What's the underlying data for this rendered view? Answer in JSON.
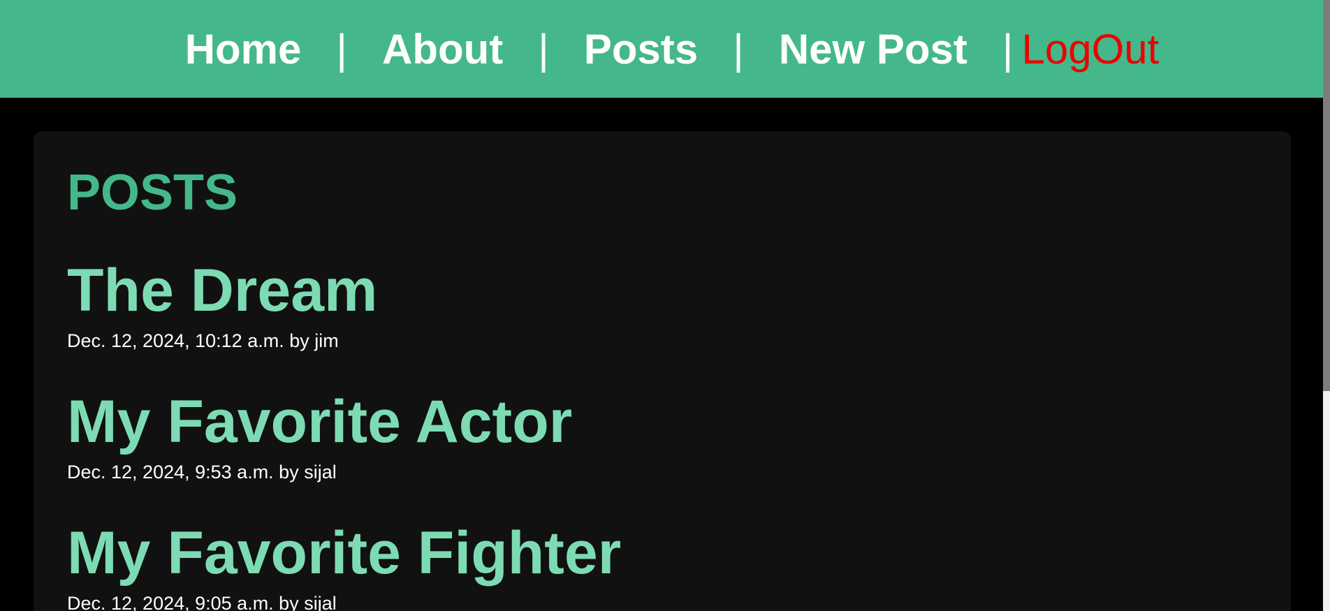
{
  "nav": {
    "home": "Home",
    "about": "About",
    "posts": "Posts",
    "new_post": "New Post",
    "logout": "LogOut",
    "separator": "|"
  },
  "main": {
    "title": "POSTS",
    "posts": [
      {
        "title": "The Dream",
        "meta": "Dec. 12, 2024, 10:12 a.m. by jim"
      },
      {
        "title": "My Favorite Actor",
        "meta": "Dec. 12, 2024, 9:53 a.m. by sijal"
      },
      {
        "title": "My Favorite Fighter",
        "meta": "Dec. 12, 2024, 9:05 a.m. by sijal"
      }
    ]
  },
  "colors": {
    "navbar": "#44b88a",
    "title": "#44b88a",
    "post_title": "#7ddbb3",
    "logout": "#ee0000",
    "card": "#111111",
    "background": "#000000"
  }
}
